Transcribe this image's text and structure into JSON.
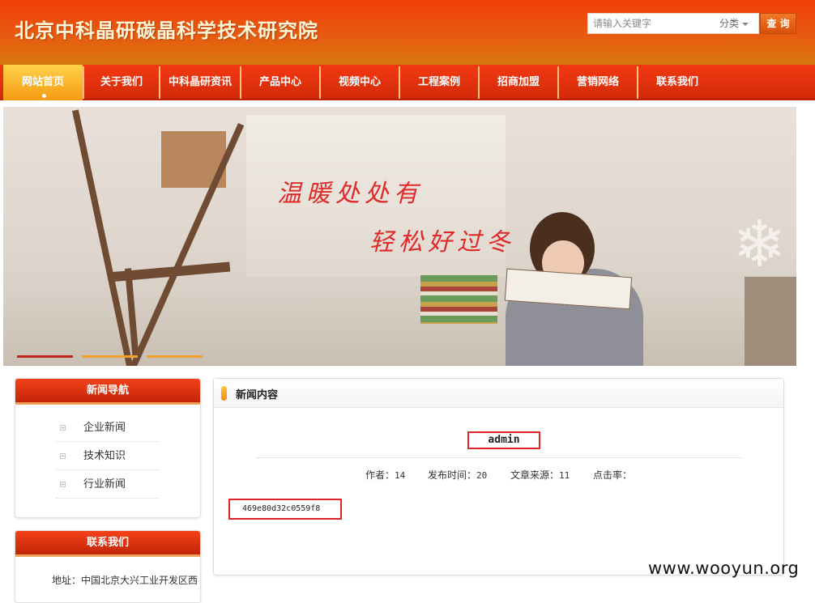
{
  "header": {
    "site_title": "北京中科晶研碳晶科学技术研究院",
    "search_placeholder": "请输入关键字",
    "category_label": "分类",
    "search_button": "查 询"
  },
  "nav": {
    "items": [
      {
        "label": "网站首页",
        "active": true
      },
      {
        "label": "关于我们"
      },
      {
        "label": "中科晶研资讯"
      },
      {
        "label": "产品中心"
      },
      {
        "label": "视频中心"
      },
      {
        "label": "工程案例"
      },
      {
        "label": "招商加盟"
      },
      {
        "label": "营销网络"
      },
      {
        "label": "联系我们"
      }
    ]
  },
  "banner": {
    "line1": "温暖处处有",
    "line2": "轻松好过冬",
    "indicator_colors": [
      "#c0251e",
      "#f0a22c",
      "#f0a22c"
    ]
  },
  "sidebar": {
    "news_nav_title": "新闻导航",
    "news_items": [
      "企业新闻",
      "技术知识",
      "行业新闻"
    ],
    "contact_title": "联系我们",
    "address": "地址：中国北京大兴工业开发区西"
  },
  "article": {
    "section_title": "新闻内容",
    "title": "admin",
    "author_label": "作者：",
    "author_value": "14",
    "time_label": "发布时间：",
    "time_value": "20",
    "source_label": "文章来源：",
    "source_value": "11",
    "clicks_label": "点击率：",
    "body": "469e80d32c0559f8"
  },
  "watermark": "www.wooyun.org",
  "colors": {
    "brand_red": "#e0242a",
    "nav_active": "#f59a12",
    "header_orange": "#e85a10"
  }
}
